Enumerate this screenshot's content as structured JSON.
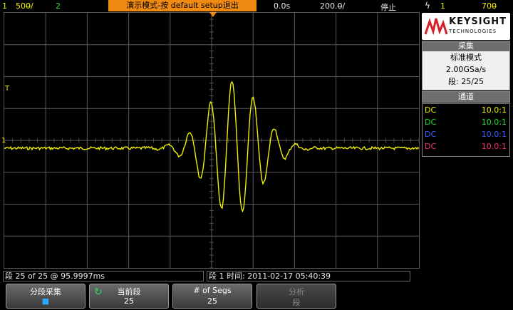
{
  "topbar": {
    "ch1_num": "1",
    "ch1_scale": "500̶/",
    "ch2_num": "2",
    "demo_banner": "演示模式-按 default setup退出",
    "time_offset": "0.0s",
    "timebase": "200.0̶/",
    "run_state": "停止",
    "trigger_icon": "lightning-icon",
    "trig_source": "1",
    "trig_level": "700̶"
  },
  "logo": {
    "name": "KEYSIGHT",
    "sub": "TECHNOLOGIES"
  },
  "acquire": {
    "header": "采集",
    "mode": "标准模式",
    "rate": "2.00GSa/s",
    "segment": "段: 25/25"
  },
  "channels": {
    "header": "通道",
    "rows": [
      {
        "coupling": "DC",
        "probe": "10.0:1",
        "color": "#f0f000"
      },
      {
        "coupling": "DC",
        "probe": "10.0:1",
        "color": "#22e022"
      },
      {
        "coupling": "DC",
        "probe": "10.0:1",
        "color": "#3c5cff"
      },
      {
        "coupling": "DC",
        "probe": "10.0:1",
        "color": "#ff2a7a"
      }
    ]
  },
  "markers": {
    "trigger_level_label": "T",
    "ch1_ground_label": "1"
  },
  "bottom": {
    "segment_info": "段  25 of   25 @ 95.9997ms",
    "segment_time": "段 1 时间: 2011-02-17 05:40:39"
  },
  "softkeys": [
    {
      "label": "分段采集",
      "value": "■"
    },
    {
      "label": "当前段",
      "value": "25"
    },
    {
      "label": "# of Segs",
      "value": "25"
    },
    {
      "label": "分析",
      "value": "段"
    }
  ],
  "colors": {
    "trace": "#f0f000",
    "grid": "#5a5a5a",
    "demo_banner": "#f08a10"
  }
}
